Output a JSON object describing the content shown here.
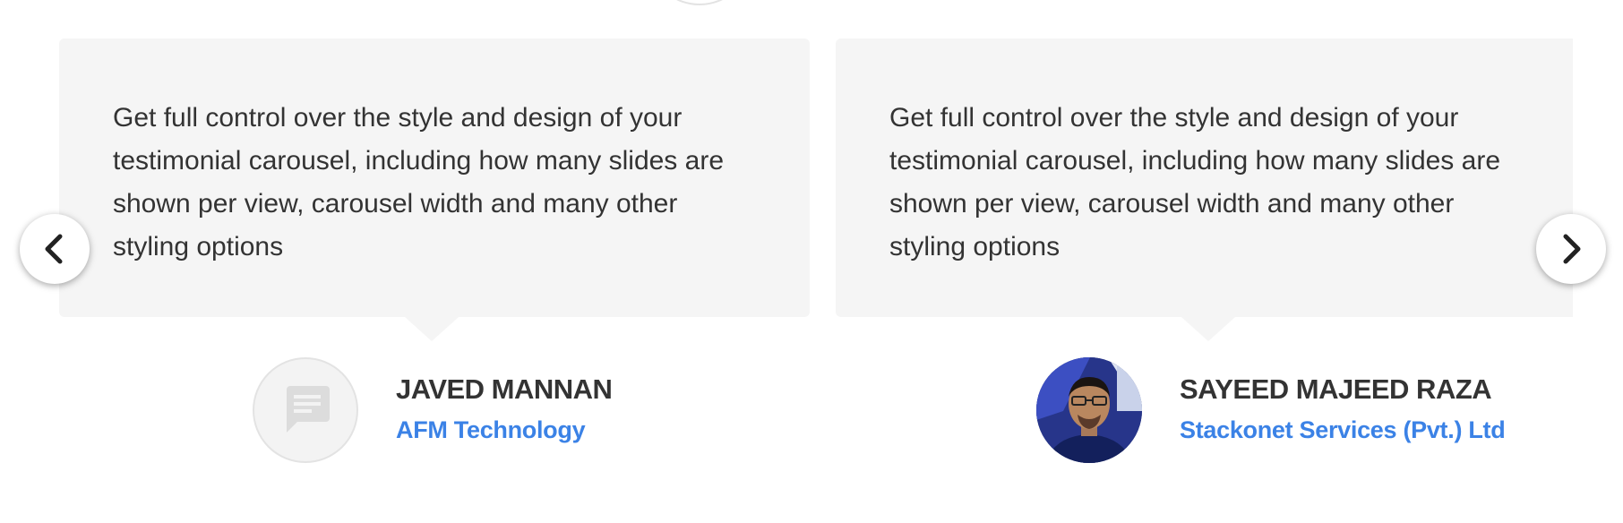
{
  "carousel": {
    "slides": [
      {
        "quote": "Get full control over the style and design of your testimonial carousel, including how many slides are shown per view, carousel width and many other styling options",
        "name": "JAVED MANNAN",
        "company": "AFM Technology",
        "avatar": "placeholder-chat-icon"
      },
      {
        "quote": "Get full control over the style and design of your testimonial carousel, including how many slides are shown per view, carousel width and many other styling options",
        "name": "SAYEED MAJEED RAZA",
        "company": "Stackonet Services (Pvt.) Ltd",
        "avatar": "profile-photo"
      }
    ],
    "nav": {
      "prev_icon": "chevron-left-icon",
      "next_icon": "chevron-right-icon"
    }
  },
  "colors": {
    "bubble_bg": "#f5f5f5",
    "text": "#333333",
    "company": "#3b82e6",
    "placeholder_icon": "#dddddd"
  }
}
